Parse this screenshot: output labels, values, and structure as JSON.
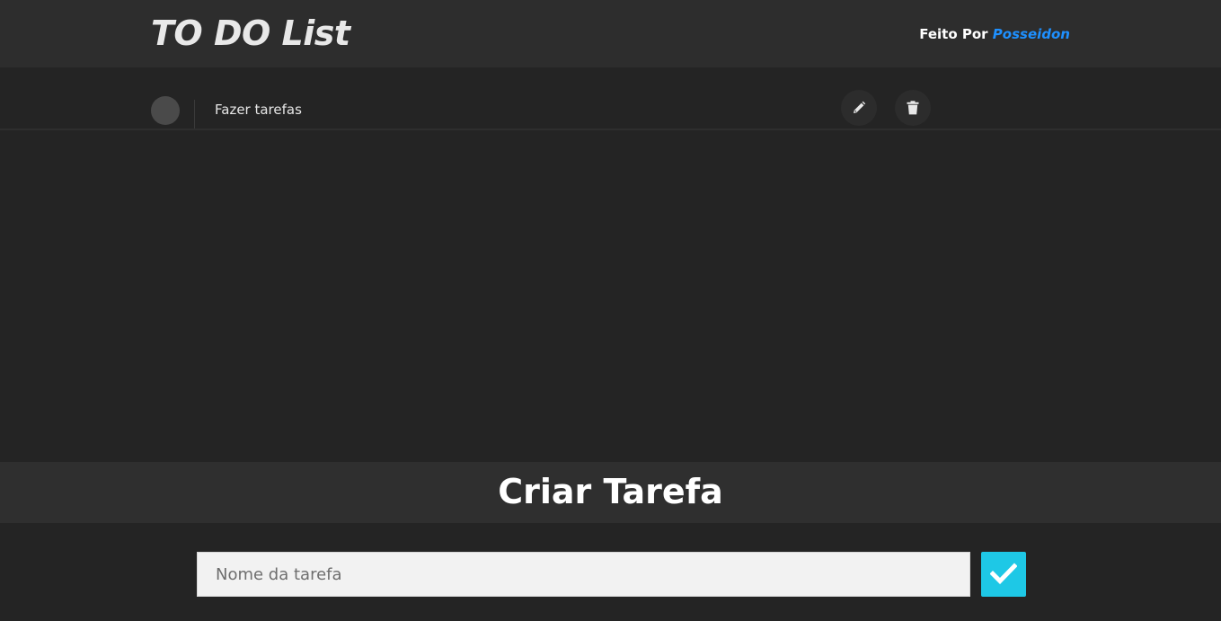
{
  "header": {
    "title": "TO DO List",
    "credit_prefix": "Feito Por",
    "credit_author": "Posseidon"
  },
  "tasks": [
    {
      "text": "Fazer tarefas",
      "edit_icon": "pencil-icon",
      "delete_icon": "trash-icon"
    }
  ],
  "create": {
    "title": "Criar Tarefa",
    "input_placeholder": "Nome da tarefa",
    "input_value": "",
    "submit_icon": "checkmark-icon"
  },
  "colors": {
    "background": "#242424",
    "header": "#2d2d2d",
    "banner": "#2f2f2f",
    "accent": "#1ec8e6",
    "author": "#1e90ff"
  }
}
